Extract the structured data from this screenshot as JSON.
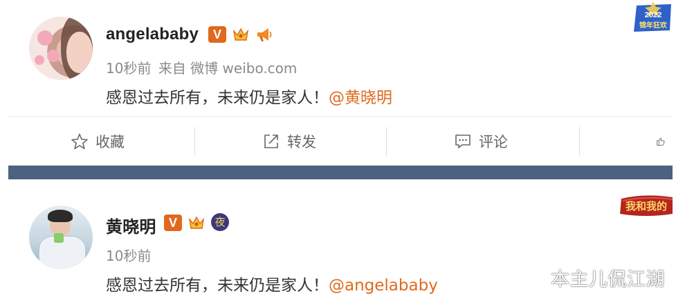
{
  "post1": {
    "username": "angelababy",
    "verified_badge": "V",
    "time": "10秒前",
    "source": "来自 微博 weibo.com",
    "content_text": "感恩过去所有，未来仍是家人！",
    "mention": "@黄晓明",
    "icons": [
      "verified-icon",
      "crown-icon",
      "megaphone-icon"
    ]
  },
  "actions": [
    {
      "label": "收藏",
      "icon": "star-icon"
    },
    {
      "label": "转发",
      "icon": "share-icon"
    },
    {
      "label": "评论",
      "icon": "comment-icon"
    },
    {
      "label": "",
      "icon": "thumbs-up-icon"
    }
  ],
  "post2": {
    "username": "黄晓明",
    "verified_badge": "V",
    "night_badge": "夜",
    "time": "10秒前",
    "content_text": "感恩过去所有，未来仍是家人！",
    "mention": "@angelababy",
    "icons": [
      "verified-icon",
      "crown-icon",
      "night-badge-icon"
    ]
  },
  "decorations": {
    "badge_year": "2022",
    "badge_text": "锦年狂欢",
    "banner_text": "我和我的"
  },
  "watermark": "本主儿侃江湖",
  "colors": {
    "accent": "#e0691d",
    "band": "#4d6180",
    "meta_text": "#8a8a8a"
  }
}
